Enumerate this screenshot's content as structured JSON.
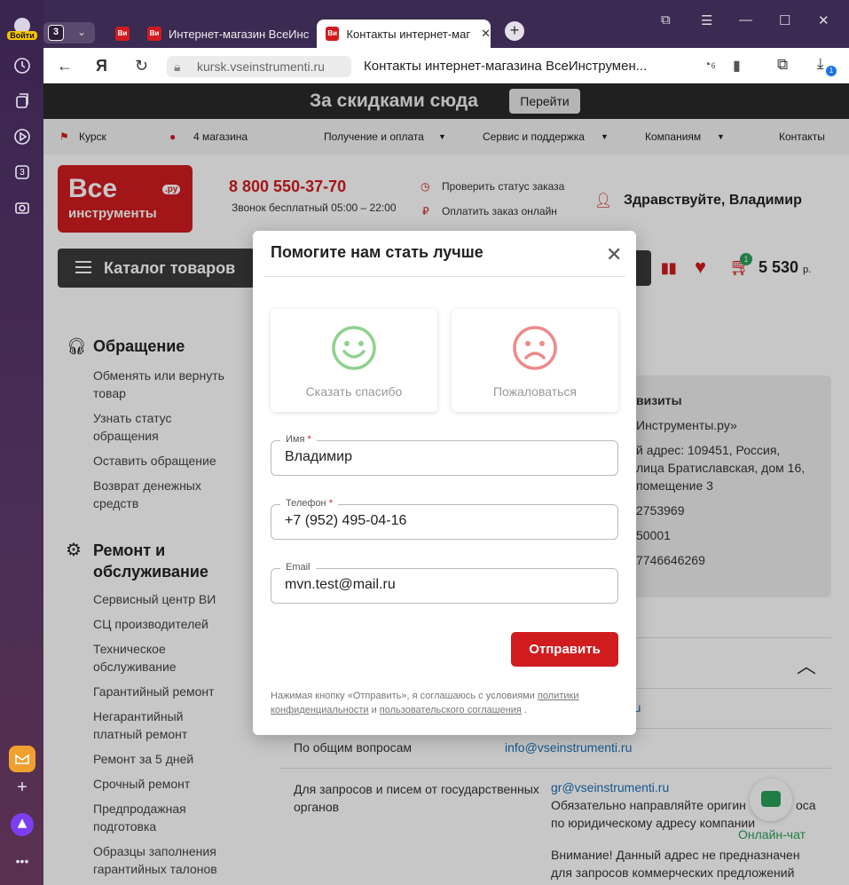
{
  "browser": {
    "login_label": "Войти",
    "tab_group_count": "3",
    "tabs": [
      {
        "favicon": "Ви",
        "title": ""
      },
      {
        "favicon": "Ви",
        "title": "Интернет-магазин ВсеИнс"
      },
      {
        "favicon": "Ви",
        "title": "Контакты интернет-маг"
      }
    ],
    "sidebar_badge": "3",
    "url": "kursk.vseinstrumenti.ru",
    "page_title": "Контакты интернет-магазина ВсеИнструмен...",
    "tracker_count": "6",
    "downloads_badge": "1"
  },
  "promo": {
    "text": "За скидками сюда",
    "button": "Перейти"
  },
  "topnav": {
    "city": "Курск",
    "stores": "4 магазина",
    "delivery": "Получение и оплата",
    "service": "Сервис и поддержка",
    "companies": "Компаниям",
    "contacts": "Контакты"
  },
  "header": {
    "logo_line1": "Все",
    "logo_line2": "инструменты",
    "logo_ru": ".ру",
    "phone": "8 800 550-37-70",
    "phone_note": "Звонок бесплатный 05:00 – 22:00",
    "check_status": "Проверить статус заказа",
    "pay_online": "Оплатить заказ онлайн",
    "greeting": "Здравствуйте, Владимир",
    "catalog": "Каталог товаров",
    "cart_count": "1",
    "cart_sum": "5 530",
    "currency": "р."
  },
  "side": {
    "sec1_title": "Обращение",
    "sec1_links": [
      "Обменять или вернуть товар",
      "Узнать статус обращения",
      "Оставить обращение",
      "Возврат денежных средств"
    ],
    "sec2_title": "Ремонт и обслуживание",
    "sec2_links": [
      "Сервисный центр ВИ",
      "СЦ производителей",
      "Техническое обслуживание",
      "Гарантийный ремонт",
      "Негарантийный платный ремонт",
      "Ремонт за 5 дней",
      "Срочный ремонт",
      "Предпродажная подготовка",
      "Образцы заполнения гарантийных талонов"
    ]
  },
  "right": {
    "req_title": "визиты",
    "req_lines": [
      "Инструменты.ру»",
      "й адрес: 109451, Россия,",
      "лица Братиславская, дом 16,",
      "помещение 3",
      "2753969",
      "50001",
      "7746646269"
    ],
    "row_email_partial": "ru",
    "general_label": "По общим вопросам",
    "general_email": "info@vseinstrumenti.ru",
    "gov_label": "Для запросов и писем от государственных органов",
    "gov_email": "gr@vseinstrumenti.ru",
    "gov_note1": "Обязательно направляйте оригин",
    "gov_note1_end": "оса",
    "gov_note2": "по юридическому адресу компании",
    "gov_note3": "Внимание! Данный адрес не предназначен",
    "gov_note4": "для запросов коммерческих предложений",
    "chat_label": "Онлайн-чат"
  },
  "modal": {
    "title": "Помогите нам стать лучше",
    "thanks": "Сказать спасибо",
    "complain": "Пожаловаться",
    "name_label": "Имя",
    "name_value": "Владимир",
    "phone_label": "Телефон",
    "phone_value": "+7 (952) 495-04-16",
    "email_label": "Email",
    "email_value": "mvn.test@mail.ru",
    "submit": "Отправить",
    "consent_pre": "Нажимая кнопку «Отправить», я соглашаюсь с условиями ",
    "consent_link1": "политики конфиденциальности",
    "consent_mid": " и ",
    "consent_link2": "пользовательского соглашения",
    "consent_end": " .",
    "required_mark": "*"
  },
  "colors": {
    "brand": "#d01c1f",
    "happy": "#8fd18f",
    "sad": "#ee8a8a",
    "chat": "#2aa05a"
  }
}
